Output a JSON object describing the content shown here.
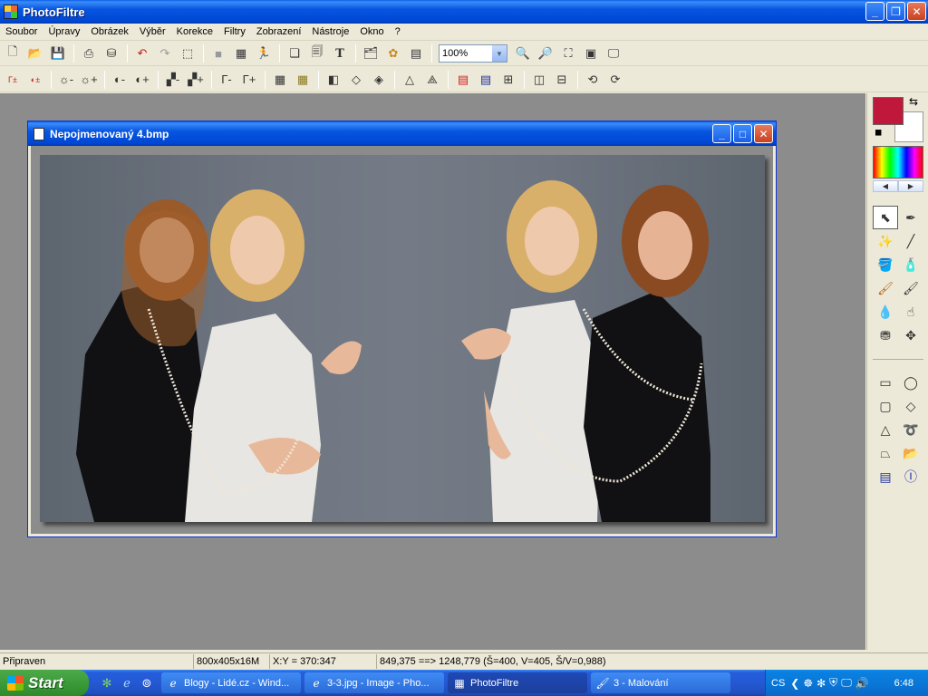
{
  "window": {
    "title": "PhotoFiltre"
  },
  "menu": [
    "Soubor",
    "Úpravy",
    "Obrázek",
    "Výběr",
    "Korekce",
    "Filtry",
    "Zobrazení",
    "Nástroje",
    "Okno",
    "?"
  ],
  "toolbar": {
    "zoom_value": "100%"
  },
  "document": {
    "title": "Nepojmenovaný 4.bmp"
  },
  "palette": {
    "fg_color": "#c0183a",
    "bg_color": "#ffffff"
  },
  "status": {
    "state": "Připraven",
    "size": "800x405x16M",
    "coords": "X:Y = 370:347",
    "selection": "849,375 ==> 1248,779 (Š=400, V=405, Š/V=0,988)"
  },
  "taskbar": {
    "start": "Start",
    "tasks": [
      {
        "label": "Blogy - Lidé.cz - Wind...",
        "icon": "ie-icon",
        "active": false
      },
      {
        "label": "3-3.jpg - Image - Pho...",
        "icon": "ie-icon",
        "active": false
      },
      {
        "label": "PhotoFiltre",
        "icon": "photofiltre-icon",
        "active": true
      },
      {
        "label": "3 - Malování",
        "icon": "paint-icon",
        "active": false
      }
    ],
    "lang": "CS",
    "clock": "6:48"
  }
}
